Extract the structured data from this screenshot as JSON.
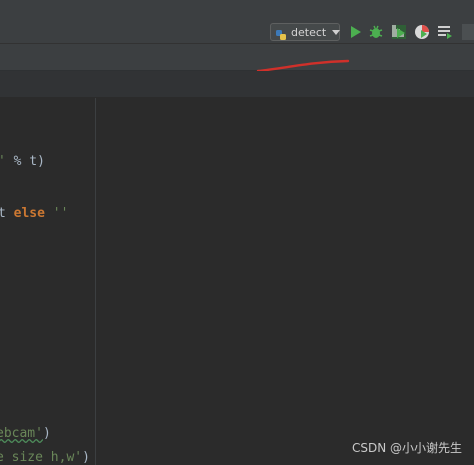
{
  "toolbar": {
    "run_config_label": "detect",
    "icons": [
      "python-file-icon",
      "run-icon",
      "debug-icon",
      "coverage-icon",
      "profile-icon",
      "run-config-list-icon"
    ]
  },
  "code_lines": [
    {
      "segments": [
        {
          "t": "'",
          "c": "str"
        },
        {
          "t": " % t)",
          "c": "plain"
        }
      ]
    },
    {
      "segments": [
        {
          "t": "t ",
          "c": "plain"
        },
        {
          "t": "else",
          "c": "kw"
        },
        {
          "t": " ''",
          "c": "str"
        }
      ]
    },
    {
      "segments": [
        {
          "t": "ebcam'",
          "c": "str"
        },
        {
          "t": ")",
          "c": "plain"
        }
      ]
    },
    {
      "segments": [
        {
          "t": "e size h,w'",
          "c": "str"
        },
        {
          "t": ")",
          "c": "plain"
        }
      ]
    }
  ],
  "watermark": "CSDN @小小谢先生",
  "colors": {
    "background": "#2b2b2b",
    "toolbar": "#3c3f41",
    "run_green": "#4caf50",
    "annotation_red": "#d0302a",
    "string_green": "#6a8759",
    "keyword_orange": "#cc7832"
  }
}
